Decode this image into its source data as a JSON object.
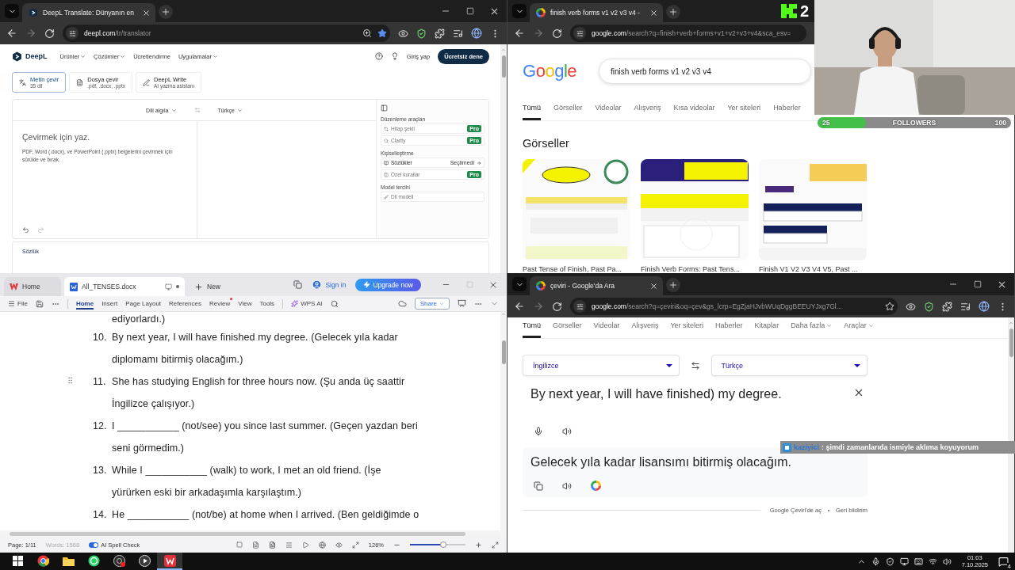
{
  "deepl_browser": {
    "tab_title": "DeepL Translate: Dünyanın en",
    "url_host": "deepl.com",
    "url_path": "/tr/translator",
    "bookmarked": true
  },
  "deepl": {
    "brand": "DeepL",
    "nav": [
      {
        "label": "Ürünler",
        "kind": "menu"
      },
      {
        "label": "Çözümler",
        "kind": "menu"
      },
      {
        "label": "Ücretlendirme",
        "kind": "link"
      },
      {
        "label": "Uygulamalar",
        "kind": "menu"
      }
    ],
    "login": "Giriş yap",
    "cta": "Ücretsiz dene",
    "modes": [
      {
        "title": "Metin çevir",
        "subtitle": "35 dil",
        "selected": true
      },
      {
        "title": "Dosya çevir",
        "subtitle": ".pdf, .docx, .pptx",
        "selected": false
      },
      {
        "title": "DeepL Write",
        "subtitle": "AI yazma asistanı",
        "selected": false
      }
    ],
    "source_language": "Dili algıla",
    "target_language": "Türkçe",
    "placeholder": "Çevirmek için yaz.",
    "hint": "PDF, Word (.docx), ve PowerPoint (.pptx) belgelerini çevirmek için sürükle ve bırak.",
    "side_sections": [
      {
        "heading": "Düzenleme araçları",
        "items": [
          {
            "label": "Hitap şekli",
            "kind": "pro",
            "badge": "Pro"
          },
          {
            "label": "Clarity",
            "kind": "pro",
            "badge": "Pro"
          }
        ]
      },
      {
        "heading": "Kişiselleştirme",
        "items": [
          {
            "label": "Sözlükler",
            "kind": "option",
            "status": "Seçilmedi"
          },
          {
            "label": "Özel kurallar",
            "kind": "pro",
            "badge": "Pro"
          }
        ]
      },
      {
        "heading": "Model tercihi",
        "items": [
          {
            "label": "Dil modeli",
            "kind": "plain"
          }
        ]
      }
    ],
    "dictionary_title": "Sözlük"
  },
  "google_browser": {
    "tab_title": "finish verb forms v1 v2 v3 v4 -",
    "url_host": "google.com",
    "url_path": "/search?q=finish+verb+forms+v1+v2+v3+v4&sca_esv="
  },
  "google": {
    "logo": "Google",
    "query": "finish verb forms v1 v2 v3 v4",
    "tabs": [
      {
        "label": "Tümü",
        "selected": true
      },
      {
        "label": "Görseller",
        "selected": false
      },
      {
        "label": "Videolar",
        "selected": false
      },
      {
        "label": "Alışveriş",
        "selected": false
      },
      {
        "label": "Kısa videolar",
        "selected": false
      },
      {
        "label": "Yer siteleri",
        "selected": false
      },
      {
        "label": "Haberler",
        "selected": false
      }
    ],
    "images_heading": "Görseller",
    "images": [
      {
        "kind": "picture",
        "caption": "Past Tense of Finish, Past Pa..."
      },
      {
        "kind": "picture",
        "caption": "Finish Verb Forms: Past Tens..."
      },
      {
        "kind": "picture",
        "caption": "Finish V1 V2 V3 V4 V5, Past ..."
      }
    ]
  },
  "stream": {
    "counter": "2",
    "followers": {
      "start": "25",
      "label": "FOLLOWERS",
      "end": "100",
      "level": 0.25
    },
    "chat": {
      "user": "kaziyici",
      "message": ": şimdi zamanlarıda ismiyle aklıma koyuyorum"
    }
  },
  "wps": {
    "tabs": [
      {
        "label": "Home",
        "kind": "home",
        "selected": false
      },
      {
        "label": "All_TENSES.docx",
        "kind": "doc",
        "selected": true
      }
    ],
    "new_tab": "New",
    "sign_in": "Sign in",
    "upgrade": "Upgrade now",
    "file": "File",
    "menu": [
      {
        "label": "Home",
        "selected": true,
        "dot": false
      },
      {
        "label": "Insert",
        "selected": false,
        "dot": false
      },
      {
        "label": "Page Layout",
        "selected": false,
        "dot": false
      },
      {
        "label": "References",
        "selected": false,
        "dot": false
      },
      {
        "label": "Review",
        "selected": false,
        "dot": true
      },
      {
        "label": "View",
        "selected": false,
        "dot": false
      },
      {
        "label": "Tools",
        "selected": false,
        "dot": false
      }
    ],
    "ai": "WPS AI",
    "share": "Share",
    "document": [
      {
        "handle": false,
        "lines": [
          "ediyorlardı.)"
        ]
      },
      {
        "number": "10.",
        "handle": false,
        "lines": [
          "By next year, I will have finished my degree. (Gelecek yıla kadar",
          "diplomamı bitirmiş olacağım.)"
        ]
      },
      {
        "number": "11.",
        "handle": true,
        "lines": [
          "She has studying English for three hours now. (Şu anda üç saattir",
          "İngilizce çalışıyor.)"
        ]
      },
      {
        "number": "12.",
        "handle": false,
        "lines": [
          "I ___________ (not/see) you since last summer. (Geçen yazdan beri",
          "seni görmedim.)"
        ]
      },
      {
        "number": "13.",
        "handle": false,
        "lines": [
          "While I ___________ (walk) to work, I met an old friend. (İşe",
          "yürürken eski bir arkadaşımla karşılaştım.)"
        ]
      },
      {
        "number": "14.",
        "handle": false,
        "lines": [
          "He ___________ (not/be) at home when I arrived. (Ben geldiğimde o"
        ]
      }
    ],
    "status": {
      "page": "Page: 1/11",
      "words": "Words: 1568",
      "spell_label": "AI Spell Check",
      "spell_on": true,
      "zoom": "126%",
      "zoom_slider": {
        "level": 0.6
      }
    }
  },
  "translate_browser": {
    "tab_title": "çeviri - Google'da Ara",
    "url_host": "google.com",
    "url_path": "/search?q=çeviri&oq=çev&gs_lcrp=EgZjaHJvbWUqDggBEEUYJxg7Gl...",
    "bookmarked": false
  },
  "translate": {
    "tabs": [
      {
        "label": "Tümü",
        "kind": "link",
        "selected": true
      },
      {
        "label": "Görseller",
        "kind": "link",
        "selected": false
      },
      {
        "label": "Videolar",
        "kind": "link",
        "selected": false
      },
      {
        "label": "Alışveriş",
        "kind": "link",
        "selected": false
      },
      {
        "label": "Yer siteleri",
        "kind": "link",
        "selected": false
      },
      {
        "label": "Haberler",
        "kind": "link",
        "selected": false
      },
      {
        "label": "Kitaplar",
        "kind": "link",
        "selected": false
      },
      {
        "label": "Daha fazla",
        "kind": "menu",
        "selected": false
      },
      {
        "label": "Araçlar",
        "kind": "menu",
        "selected": false
      }
    ],
    "source_language": "İngilizce",
    "target_language": "Türkçe",
    "source_text": "By next year, I will have finished) my degree.",
    "result_text": "Gelecek yıla kadar lisansımı bitirmiş olacağım.",
    "links": [
      "Google Çeviri'de aç",
      "Geri bildirim"
    ]
  },
  "taskbar": {
    "apps": [
      {
        "kind": "chrome",
        "selected": false
      },
      {
        "kind": "files",
        "selected": false
      },
      {
        "kind": "whatsapp",
        "selected": false
      },
      {
        "kind": "recorder",
        "selected": false
      },
      {
        "kind": "player",
        "selected": false
      },
      {
        "kind": "wps",
        "selected": true
      }
    ],
    "time": "01:03",
    "date": "7.10.2025",
    "notifications": "4"
  }
}
